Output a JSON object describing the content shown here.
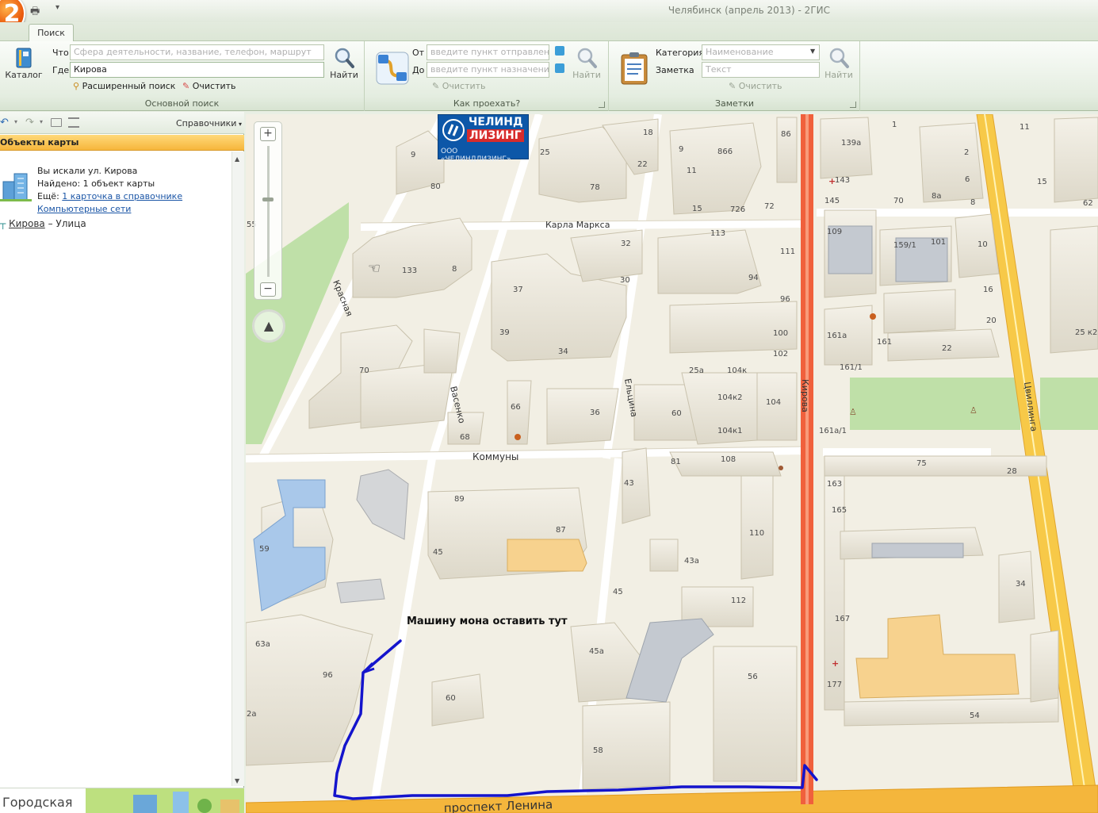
{
  "window": {
    "title": "Челябинск (апрель 2013)  -  2ГИС",
    "logo_text": "2"
  },
  "tabs": [
    {
      "label": "Поиск",
      "active": true
    }
  ],
  "ribbon": {
    "main_search": {
      "catalog_label": "Каталог",
      "what_label": "Что",
      "what_placeholder": "Сфера деятельности, название, телефон, маршрут",
      "where_label": "Где",
      "where_value": "Кирова",
      "find_label": "Найти",
      "advanced_label": "Расширенный поиск",
      "clear_label": "Очистить",
      "group_label": "Основной поиск"
    },
    "route": {
      "from_label": "От",
      "from_placeholder": "введите пункт отправления",
      "to_label": "До",
      "to_placeholder": "введите пункт назначения",
      "find_label": "Найти",
      "clear_label": "Очистить",
      "group_label": "Как проехать?"
    },
    "notes": {
      "category_label": "Категория",
      "category_value": "Наименование",
      "note_label": "Заметка",
      "note_placeholder": "Текст",
      "find_label": "Найти",
      "clear_label": "Очистить",
      "group_label": "Заметки"
    }
  },
  "panel": {
    "directories_label": "Справочники",
    "header": "Объекты карты",
    "result": {
      "searched": "Вы искали ул. Кирова",
      "found": "Найдено: 1 объект карты",
      "more_prefix": "Ещё:",
      "more_link": "1 карточка в справочнике",
      "link2": "Компьютерные сети"
    },
    "street": {
      "name": "Кирова",
      "dash": "–",
      "type": "Улица"
    },
    "banner": "Городская"
  },
  "map": {
    "streets": [
      "Карла Маркса",
      "Красная",
      "Васенко",
      "Ельцина",
      "Коммуны",
      "Кирова",
      "Цвиллинга",
      "проспект Ленина"
    ],
    "annotation": "Машину мона оставить тут",
    "ad": {
      "line1": "ЧЕЛИНД",
      "line2": "ЛИЗИНГ",
      "line3": "ООО «ЧЕЛИНДЛИЗИНГ»"
    },
    "house_numbers": {
      "n133": "133",
      "n8": "8",
      "n70": "70",
      "n80": "80",
      "n9a": "9",
      "n37": "37",
      "n39": "39",
      "n34": "34",
      "n32": "32",
      "n30": "30",
      "n66": "66",
      "n68": "68",
      "n36": "36",
      "n25": "25",
      "n78": "78",
      "n18": "18",
      "n22": "22",
      "n9b": "9",
      "n866": "866",
      "n11": "11",
      "n15": "15",
      "n726": "726",
      "n72": "72",
      "n86": "86",
      "n113": "113",
      "n111": "111",
      "n94": "94",
      "n96": "96",
      "n100": "100",
      "n102": "102",
      "n25a": "25а",
      "n104k": "104к",
      "n104k2": "104к2",
      "n104": "104",
      "n60": "60",
      "n104k1": "104к1",
      "n1": "1",
      "n139a": "139а",
      "n2": "2",
      "n143": "143",
      "n6": "6",
      "n145": "145",
      "n8a": "8а",
      "n70b": "70",
      "n8b": "8",
      "n15b": "15",
      "n62": "62",
      "n11b": "11",
      "n109": "109",
      "n1591": "159/1",
      "n101": "101",
      "n10": "10",
      "n16": "16",
      "n20": "20",
      "n161a": "161а",
      "n161": "161",
      "n22b": "22",
      "n1611": "161/1",
      "n25k2": "25 к2",
      "n161a1": "161а/1",
      "n59": "59",
      "n89": "89",
      "n87": "87",
      "n45": "45",
      "n63a": "63а",
      "n96b": "96",
      "n60b": "60",
      "n81": "81",
      "n108": "108",
      "n43": "43",
      "n110": "110",
      "n43a": "43а",
      "n45b": "45",
      "n112": "112",
      "n45a": "45а",
      "n56": "56",
      "n58": "58",
      "n75": "75",
      "n28": "28",
      "n163": "163",
      "n165": "165",
      "n34b": "34",
      "n167": "167",
      "n177": "177",
      "n54": "54",
      "n2a": "2а",
      "n55": "55"
    }
  },
  "colors": {
    "ribbon_bg": "#e4ede0",
    "panel_header": "#f6b63c",
    "map_bg": "#f2efe4",
    "kirova_street": "#f0603c",
    "main_road": "#f7c948",
    "route_line": "#1414cc",
    "park": "#bfe0a8"
  },
  "icons": {
    "print": "printer-icon",
    "catalog": "book-icon",
    "search": "magnifier-icon",
    "advanced": "advanced-search-icon",
    "clear": "eraser-icon",
    "route": "route-icon",
    "notes": "clipboard-icon",
    "back": "back-arrow-icon",
    "forward": "forward-arrow-icon",
    "zoom_in": "plus-icon",
    "zoom_out": "minus-icon",
    "compass": "compass-icon"
  }
}
